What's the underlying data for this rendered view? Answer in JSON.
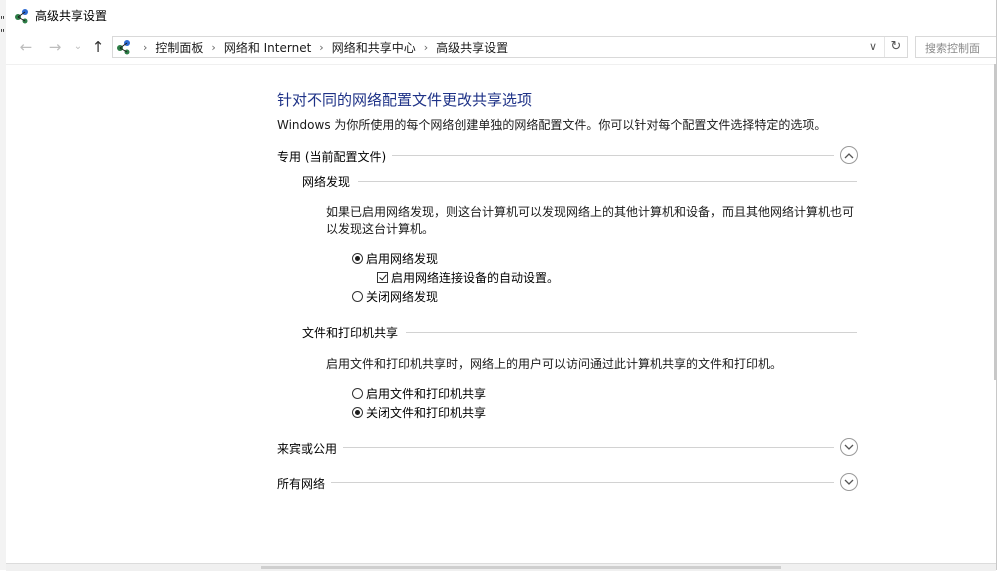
{
  "window": {
    "title": "高级共享设置"
  },
  "nav": {
    "breadcrumbs": [
      "控制面板",
      "网络和 Internet",
      "网络和共享中心",
      "高级共享设置"
    ],
    "search_placeholder": "搜索控制面"
  },
  "page": {
    "heading": "针对不同的网络配置文件更改共享选项",
    "description": "Windows 为你所使用的每个网络创建单独的网络配置文件。你可以针对每个配置文件选择特定的选项。"
  },
  "profiles": {
    "private": {
      "label": "专用 (当前配置文件)",
      "expanded": true,
      "network_discovery": {
        "title": "网络发现",
        "description": "如果已启用网络发现，则这台计算机可以发现网络上的其他计算机和设备，而且其他网络计算机也可以发现这台计算机。",
        "enable_label": "启用网络发现",
        "enable_selected": true,
        "auto_setup_label": "启用网络连接设备的自动设置。",
        "auto_setup_checked": true,
        "disable_label": "关闭网络发现",
        "disable_selected": false
      },
      "file_printer_sharing": {
        "title": "文件和打印机共享",
        "description": "启用文件和打印机共享时，网络上的用户可以访问通过此计算机共享的文件和打印机。",
        "enable_label": "启用文件和打印机共享",
        "enable_selected": false,
        "disable_label": "关闭文件和打印机共享",
        "disable_selected": true
      }
    },
    "guest_public": {
      "label": "来宾或公用",
      "expanded": false
    },
    "all_networks": {
      "label": "所有网络",
      "expanded": false
    }
  },
  "colors": {
    "heading": "#1e3287",
    "divider": "#d2d2d2"
  },
  "icons": {
    "app": "network-icon",
    "expand": "chevron-down-icon",
    "collapse": "chevron-up-icon"
  }
}
